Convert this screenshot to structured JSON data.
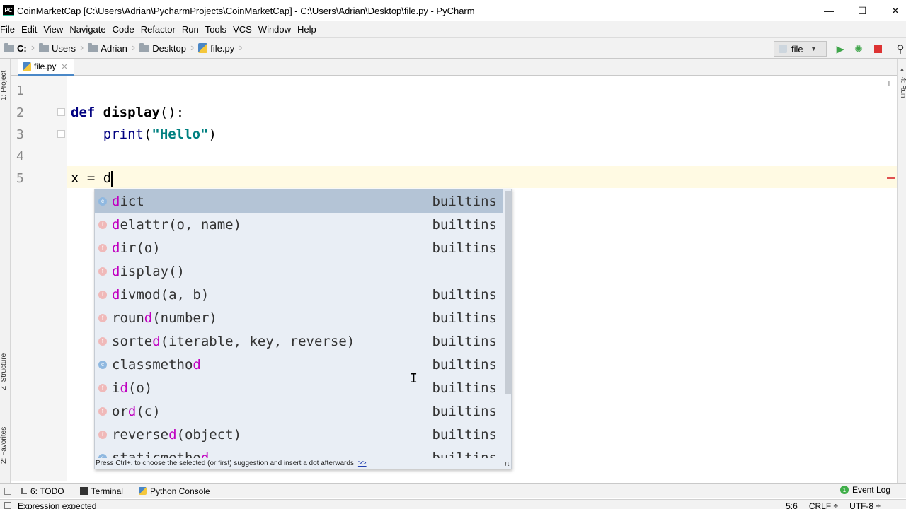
{
  "window": {
    "app_icon": "PC",
    "title": "CoinMarketCap [C:\\Users\\Adrian\\PycharmProjects\\CoinMarketCap] - C:\\Users\\Adrian\\Desktop\\file.py - PyCharm",
    "minimize_icon": "minimize-icon",
    "maximize_icon": "maximize-icon",
    "close_icon": "close-icon"
  },
  "menu": [
    "File",
    "Edit",
    "View",
    "Navigate",
    "Code",
    "Refactor",
    "Run",
    "Tools",
    "VCS",
    "Window",
    "Help"
  ],
  "breadcrumb": {
    "drive": "C:",
    "items": [
      "Users",
      "Adrian",
      "Desktop"
    ],
    "file": "file.py"
  },
  "run_config": {
    "label": "file"
  },
  "toolbar_icons": [
    "run-icon",
    "debug-icon",
    "stop-icon",
    "search-icon"
  ],
  "editor_tab": {
    "label": "file.py",
    "close": "✕"
  },
  "side_panels": {
    "left_top": "1: Project",
    "left_middle": "Z: Structure",
    "left_bottom": "2: Favorites",
    "right_top": "4: Run"
  },
  "code": {
    "line_numbers": [
      "1",
      "2",
      "3",
      "4",
      "5"
    ],
    "line2": {
      "kw": "def",
      "name": "display",
      "rest": "():"
    },
    "line3": {
      "indent": "    ",
      "builtin": "print",
      "open": "(",
      "str": "\"Hello\"",
      "close": ")"
    },
    "line5": {
      "text": "x = d"
    }
  },
  "autocomplete": {
    "items": [
      {
        "kind": "c",
        "match": "d",
        "rest": "ict",
        "source": "builtins"
      },
      {
        "kind": "f",
        "match": "d",
        "rest": "elattr(o, name)",
        "source": "builtins"
      },
      {
        "kind": "f",
        "match": "d",
        "rest": "ir(o)",
        "source": "builtins"
      },
      {
        "kind": "f",
        "match": "d",
        "rest": "isplay()",
        "source": ""
      },
      {
        "kind": "f",
        "match": "d",
        "rest": "ivmod(a, b)",
        "source": "builtins"
      },
      {
        "kind": "f",
        "prefix": "roun",
        "match": "d",
        "rest": "(number)",
        "source": "builtins"
      },
      {
        "kind": "f",
        "prefix": "sorte",
        "match": "d",
        "rest": "(iterable, key, reverse)",
        "source": "builtins"
      },
      {
        "kind": "c",
        "prefix": "classmetho",
        "match": "d",
        "rest": "",
        "source": "builtins"
      },
      {
        "kind": "f",
        "prefix": "i",
        "match": "d",
        "rest": "(o)",
        "source": "builtins"
      },
      {
        "kind": "f",
        "prefix": "or",
        "match": "d",
        "rest": "(c)",
        "source": "builtins"
      },
      {
        "kind": "f",
        "prefix": "reverse",
        "match": "d",
        "rest": "(object)",
        "source": "builtins"
      },
      {
        "kind": "c",
        "prefix": "staticmetho",
        "match": "d",
        "rest": "",
        "source": "builtins"
      }
    ],
    "hint": "Press Ctrl+. to choose the selected (or first) suggestion and insert a dot afterwards",
    "hint_link": ">>",
    "pi": "π"
  },
  "bottom_tabs": [
    {
      "label": "6: TODO",
      "icon": "todo-icon"
    },
    {
      "label": "Terminal",
      "icon": "terminal-icon"
    },
    {
      "label": "Python Console",
      "icon": "python-console-icon"
    }
  ],
  "event_log": "Event Log",
  "status": {
    "message": "Expression expected",
    "position": "5:6",
    "line_sep": "CRLF ÷",
    "encoding": "UTF-8 ÷"
  },
  "colors": {
    "accent": "#4a88c7",
    "selection": "#b4c4d6",
    "popup_bg": "#e9eef5",
    "match": "#c000c0",
    "error": "#e03030"
  }
}
